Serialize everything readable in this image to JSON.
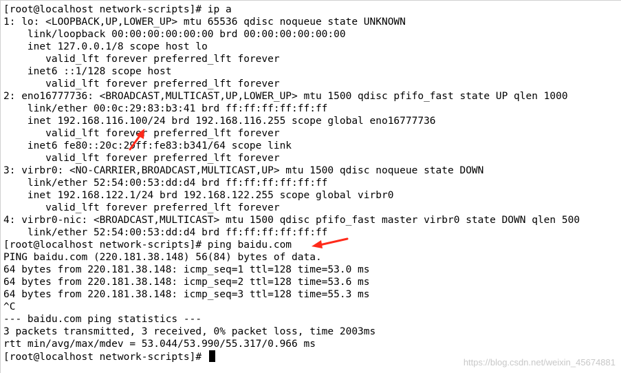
{
  "terminal": {
    "lines": [
      "[root@localhost network-scripts]# ip a",
      "1: lo: <LOOPBACK,UP,LOWER_UP> mtu 65536 qdisc noqueue state UNKNOWN",
      "    link/loopback 00:00:00:00:00:00 brd 00:00:00:00:00:00",
      "    inet 127.0.0.1/8 scope host lo",
      "       valid_lft forever preferred_lft forever",
      "    inet6 ::1/128 scope host",
      "       valid_lft forever preferred_lft forever",
      "2: eno16777736: <BROADCAST,MULTICAST,UP,LOWER_UP> mtu 1500 qdisc pfifo_fast state UP qlen 1000",
      "    link/ether 00:0c:29:83:b3:41 brd ff:ff:ff:ff:ff:ff",
      "    inet 192.168.116.100/24 brd 192.168.116.255 scope global eno16777736",
      "       valid_lft forever preferred_lft forever",
      "    inet6 fe80::20c:29ff:fe83:b341/64 scope link",
      "       valid_lft forever preferred_lft forever",
      "3: virbr0: <NO-CARRIER,BROADCAST,MULTICAST,UP> mtu 1500 qdisc noqueue state DOWN",
      "    link/ether 52:54:00:53:dd:d4 brd ff:ff:ff:ff:ff:ff",
      "    inet 192.168.122.1/24 brd 192.168.122.255 scope global virbr0",
      "       valid_lft forever preferred_lft forever",
      "4: virbr0-nic: <BROADCAST,MULTICAST> mtu 1500 qdisc pfifo_fast master virbr0 state DOWN qlen 500",
      "    link/ether 52:54:00:53:dd:d4 brd ff:ff:ff:ff:ff:ff",
      "[root@localhost network-scripts]# ping baidu.com",
      "PING baidu.com (220.181.38.148) 56(84) bytes of data.",
      "64 bytes from 220.181.38.148: icmp_seq=1 ttl=128 time=53.0 ms",
      "64 bytes from 220.181.38.148: icmp_seq=2 ttl=128 time=53.6 ms",
      "64 bytes from 220.181.38.148: icmp_seq=3 ttl=128 time=55.3 ms",
      "^C",
      "--- baidu.com ping statistics ---",
      "3 packets transmitted, 3 received, 0% packet loss, time 2003ms",
      "rtt min/avg/max/mdev = 53.044/53.990/55.317/0.966 ms",
      "[root@localhost network-scripts]# "
    ]
  },
  "watermark": "https://blog.csdn.net/weixin_45674881",
  "colors": {
    "background": "#ffffff",
    "text": "#000000",
    "arrow": "#ff2a1a"
  },
  "icons": [
    "red-arrow-icon",
    "red-arrow-icon",
    "cursor-block"
  ]
}
